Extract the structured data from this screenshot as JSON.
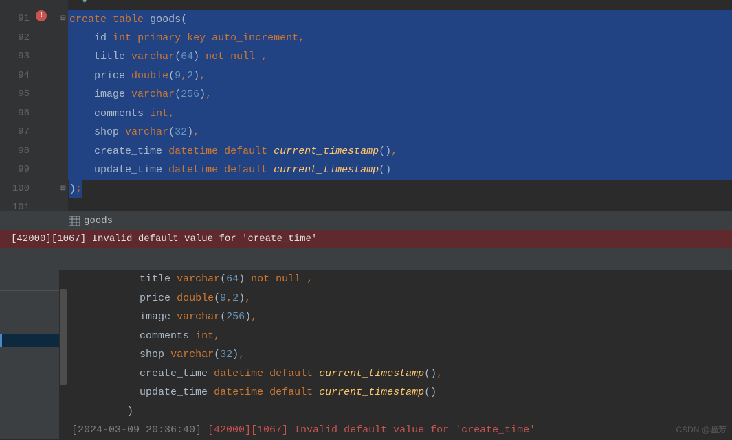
{
  "editor": {
    "partial_top": "",
    "line_numbers": [
      "91",
      "92",
      "93",
      "94",
      "95",
      "96",
      "97",
      "98",
      "99",
      "100",
      "101"
    ],
    "lines": [
      {
        "indent": "",
        "tokens": [
          {
            "t": "create",
            "c": "kw"
          },
          {
            "t": " ",
            "c": ""
          },
          {
            "t": "table",
            "c": "kw"
          },
          {
            "t": " ",
            "c": ""
          },
          {
            "t": "goods",
            "c": "ident"
          },
          {
            "t": "(",
            "c": "paren"
          }
        ],
        "hl": true,
        "first": true
      },
      {
        "indent": "    ",
        "tokens": [
          {
            "t": "id",
            "c": "ident"
          },
          {
            "t": " ",
            "c": ""
          },
          {
            "t": "int",
            "c": "type"
          },
          {
            "t": " ",
            "c": ""
          },
          {
            "t": "primary",
            "c": "kw"
          },
          {
            "t": " ",
            "c": ""
          },
          {
            "t": "key",
            "c": "kw"
          },
          {
            "t": " ",
            "c": ""
          },
          {
            "t": "auto_increment",
            "c": "kw"
          },
          {
            "t": ",",
            "c": "comma"
          }
        ],
        "hl": true
      },
      {
        "indent": "    ",
        "tokens": [
          {
            "t": "title",
            "c": "ident"
          },
          {
            "t": " ",
            "c": ""
          },
          {
            "t": "varchar",
            "c": "type"
          },
          {
            "t": "(",
            "c": "paren"
          },
          {
            "t": "64",
            "c": "num"
          },
          {
            "t": ")",
            "c": "paren"
          },
          {
            "t": " ",
            "c": ""
          },
          {
            "t": "not",
            "c": "kw"
          },
          {
            "t": " ",
            "c": ""
          },
          {
            "t": "null",
            "c": "kw"
          },
          {
            "t": " ,",
            "c": "comma"
          }
        ],
        "hl": true
      },
      {
        "indent": "    ",
        "tokens": [
          {
            "t": "price",
            "c": "ident"
          },
          {
            "t": " ",
            "c": ""
          },
          {
            "t": "double",
            "c": "type"
          },
          {
            "t": "(",
            "c": "paren"
          },
          {
            "t": "9",
            "c": "num"
          },
          {
            "t": ",",
            "c": "comma"
          },
          {
            "t": "2",
            "c": "num"
          },
          {
            "t": ")",
            "c": "paren"
          },
          {
            "t": ",",
            "c": "comma"
          }
        ],
        "hl": true
      },
      {
        "indent": "    ",
        "tokens": [
          {
            "t": "image",
            "c": "ident"
          },
          {
            "t": " ",
            "c": ""
          },
          {
            "t": "varchar",
            "c": "type"
          },
          {
            "t": "(",
            "c": "paren"
          },
          {
            "t": "256",
            "c": "num"
          },
          {
            "t": ")",
            "c": "paren"
          },
          {
            "t": ",",
            "c": "comma"
          }
        ],
        "hl": true
      },
      {
        "indent": "    ",
        "tokens": [
          {
            "t": "comments",
            "c": "ident"
          },
          {
            "t": " ",
            "c": ""
          },
          {
            "t": "int",
            "c": "type"
          },
          {
            "t": ",",
            "c": "comma"
          }
        ],
        "hl": true
      },
      {
        "indent": "    ",
        "tokens": [
          {
            "t": "shop",
            "c": "ident"
          },
          {
            "t": " ",
            "c": ""
          },
          {
            "t": "varchar",
            "c": "type"
          },
          {
            "t": "(",
            "c": "paren"
          },
          {
            "t": "32",
            "c": "num"
          },
          {
            "t": ")",
            "c": "paren"
          },
          {
            "t": ",",
            "c": "comma"
          }
        ],
        "hl": true
      },
      {
        "indent": "    ",
        "tokens": [
          {
            "t": "create_time",
            "c": "ident"
          },
          {
            "t": " ",
            "c": ""
          },
          {
            "t": "datetime",
            "c": "type"
          },
          {
            "t": " ",
            "c": ""
          },
          {
            "t": "default",
            "c": "kw"
          },
          {
            "t": " ",
            "c": ""
          },
          {
            "t": "current_timestamp",
            "c": "func"
          },
          {
            "t": "()",
            "c": "paren"
          },
          {
            "t": ",",
            "c": "comma"
          }
        ],
        "hl": true
      },
      {
        "indent": "    ",
        "tokens": [
          {
            "t": "update_time",
            "c": "ident"
          },
          {
            "t": " ",
            "c": ""
          },
          {
            "t": "datetime",
            "c": "type"
          },
          {
            "t": " ",
            "c": ""
          },
          {
            "t": "default",
            "c": "kw"
          },
          {
            "t": " ",
            "c": ""
          },
          {
            "t": "current_timestamp",
            "c": "func"
          },
          {
            "t": "()",
            "c": "paren"
          }
        ],
        "hl": true
      },
      {
        "indent": "",
        "tokens": [
          {
            "t": ")",
            "c": "paren"
          },
          {
            "t": ";",
            "c": "comma"
          }
        ],
        "hl": false,
        "partial_hl": true
      },
      {
        "indent": "",
        "tokens": [],
        "hl": false
      }
    ]
  },
  "breadcrumb": {
    "label": "goods"
  },
  "error_bar": {
    "text": "[42000][1067] Invalid default value for 'create_time'"
  },
  "console": {
    "lines": [
      {
        "indent": "           ",
        "tokens": [
          {
            "t": "title",
            "c": "ident"
          },
          {
            "t": " ",
            "c": ""
          },
          {
            "t": "varchar",
            "c": "type"
          },
          {
            "t": "(",
            "c": "paren"
          },
          {
            "t": "64",
            "c": "num"
          },
          {
            "t": ")",
            "c": "paren"
          },
          {
            "t": " ",
            "c": ""
          },
          {
            "t": "not",
            "c": "kw"
          },
          {
            "t": " ",
            "c": ""
          },
          {
            "t": "null",
            "c": "kw"
          },
          {
            "t": " ,",
            "c": "comma"
          }
        ]
      },
      {
        "indent": "           ",
        "tokens": [
          {
            "t": "price",
            "c": "ident"
          },
          {
            "t": " ",
            "c": ""
          },
          {
            "t": "double",
            "c": "type"
          },
          {
            "t": "(",
            "c": "paren"
          },
          {
            "t": "9",
            "c": "num"
          },
          {
            "t": ",",
            "c": "comma"
          },
          {
            "t": "2",
            "c": "num"
          },
          {
            "t": ")",
            "c": "paren"
          },
          {
            "t": ",",
            "c": "comma"
          }
        ]
      },
      {
        "indent": "           ",
        "tokens": [
          {
            "t": "image",
            "c": "ident"
          },
          {
            "t": " ",
            "c": ""
          },
          {
            "t": "varchar",
            "c": "type"
          },
          {
            "t": "(",
            "c": "paren"
          },
          {
            "t": "256",
            "c": "num"
          },
          {
            "t": ")",
            "c": "paren"
          },
          {
            "t": ",",
            "c": "comma"
          }
        ]
      },
      {
        "indent": "           ",
        "tokens": [
          {
            "t": "comments",
            "c": "ident"
          },
          {
            "t": " ",
            "c": ""
          },
          {
            "t": "int",
            "c": "type"
          },
          {
            "t": ",",
            "c": "comma"
          }
        ]
      },
      {
        "indent": "           ",
        "tokens": [
          {
            "t": "shop",
            "c": "ident"
          },
          {
            "t": " ",
            "c": ""
          },
          {
            "t": "varchar",
            "c": "type"
          },
          {
            "t": "(",
            "c": "paren"
          },
          {
            "t": "32",
            "c": "num"
          },
          {
            "t": ")",
            "c": "paren"
          },
          {
            "t": ",",
            "c": "comma"
          }
        ]
      },
      {
        "indent": "           ",
        "tokens": [
          {
            "t": "create_time",
            "c": "ident"
          },
          {
            "t": " ",
            "c": ""
          },
          {
            "t": "datetime",
            "c": "type"
          },
          {
            "t": " ",
            "c": ""
          },
          {
            "t": "default",
            "c": "kw"
          },
          {
            "t": " ",
            "c": ""
          },
          {
            "t": "current_timestamp",
            "c": "func"
          },
          {
            "t": "()",
            "c": "paren"
          },
          {
            "t": ",",
            "c": "comma"
          }
        ]
      },
      {
        "indent": "           ",
        "tokens": [
          {
            "t": "update_time",
            "c": "ident"
          },
          {
            "t": " ",
            "c": ""
          },
          {
            "t": "datetime",
            "c": "type"
          },
          {
            "t": " ",
            "c": ""
          },
          {
            "t": "default",
            "c": "kw"
          },
          {
            "t": " ",
            "c": ""
          },
          {
            "t": "current_timestamp",
            "c": "func"
          },
          {
            "t": "()",
            "c": "paren"
          }
        ]
      },
      {
        "indent": "         ",
        "tokens": [
          {
            "t": ")",
            "c": "paren"
          }
        ]
      }
    ],
    "error_line": {
      "ts": "[2024-03-09 20:36:40]",
      "msg": " [42000][1067] Invalid default value for 'create_time'"
    }
  },
  "watermark": "CSDN @骚芳"
}
